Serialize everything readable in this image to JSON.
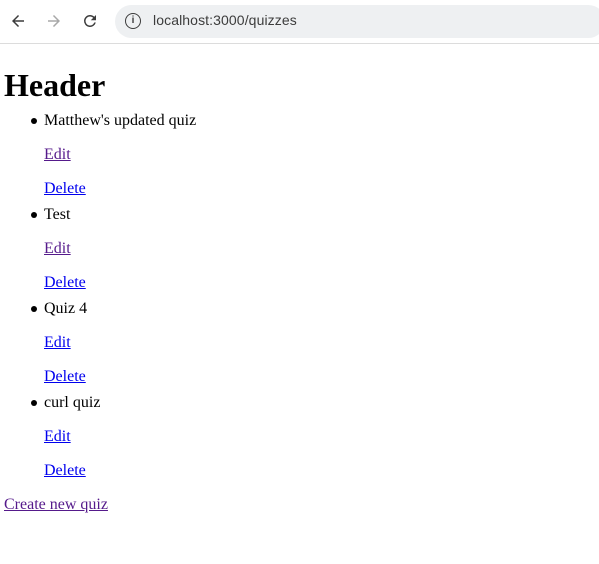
{
  "browser": {
    "url": "localhost:3000/quizzes"
  },
  "page": {
    "heading": "Header",
    "quizzes": [
      {
        "title": "Matthew's updated quiz",
        "edit_label": "Edit",
        "delete_label": "Delete"
      },
      {
        "title": "Test",
        "edit_label": "Edit",
        "delete_label": "Delete"
      },
      {
        "title": "Quiz 4",
        "edit_label": "Edit",
        "delete_label": "Delete"
      },
      {
        "title": "curl quiz",
        "edit_label": "Edit",
        "delete_label": "Delete"
      }
    ],
    "create_label": "Create new quiz"
  },
  "colors": {
    "link": "#0000ee",
    "visited_link": "#551a8b"
  }
}
